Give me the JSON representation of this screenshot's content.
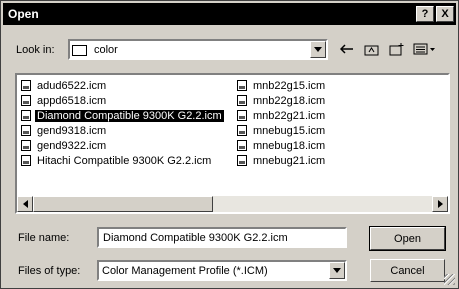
{
  "window": {
    "title": "Open",
    "help_button": "?",
    "close_button": "X"
  },
  "toolbar": {
    "lookin_label": "Look in:",
    "lookin_value": "color",
    "icons": [
      "back-arrow-icon",
      "up-folder-icon",
      "new-folder-icon",
      "view-menu-icon"
    ]
  },
  "files": {
    "column1": [
      "adud6522.icm",
      "appd6518.icm",
      "Diamond Compatible 9300K G2.2.icm",
      "gend9318.icm",
      "gend9322.icm",
      "Hitachi Compatible 9300K G2.2.icm"
    ],
    "column2": [
      "mnb22g15.icm",
      "mnb22g18.icm",
      "mnb22g21.icm",
      "mnebug15.icm",
      "mnebug18.icm",
      "mnebug21.icm"
    ],
    "selected": "Diamond Compatible 9300K G2.2.icm"
  },
  "form": {
    "filename_label": "File name:",
    "filename_value": "Diamond Compatible 9300K G2.2.icm",
    "filetype_label": "Files of type:",
    "filetype_value": "Color Management Profile (*.ICM)"
  },
  "buttons": {
    "open": "Open",
    "cancel": "Cancel"
  }
}
